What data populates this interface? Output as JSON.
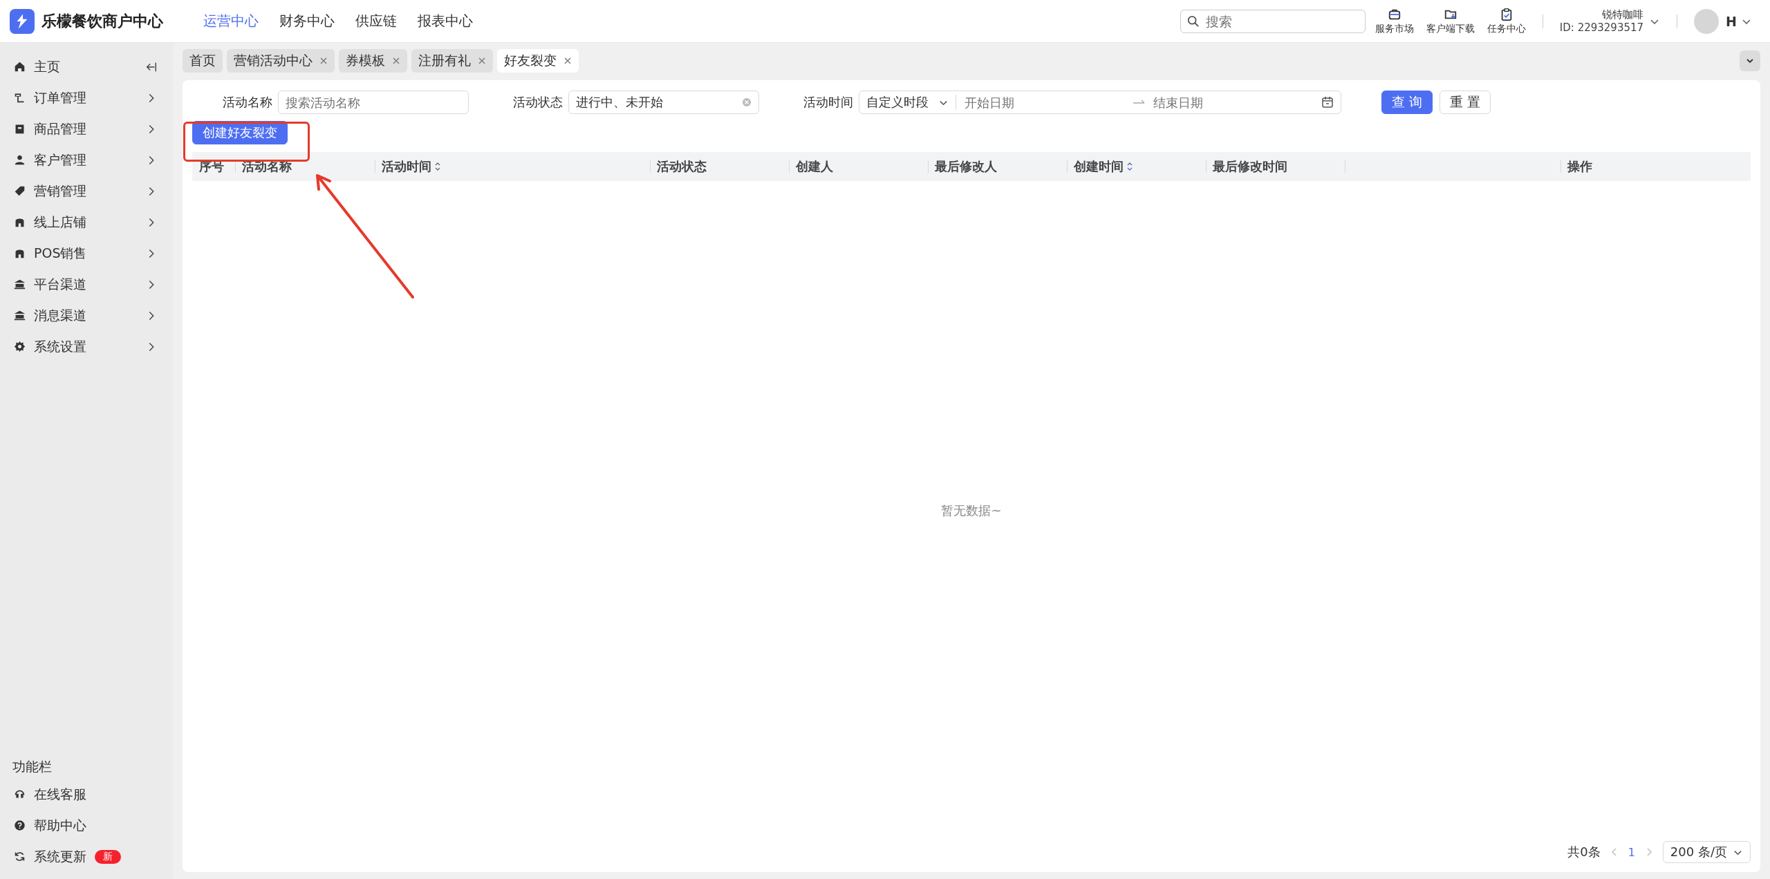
{
  "brand": {
    "name": "乐檬餐饮商户中心"
  },
  "top_nav": [
    {
      "label": "运营中心",
      "selected": true
    },
    {
      "label": "财务中心",
      "selected": false
    },
    {
      "label": "供应链",
      "selected": false
    },
    {
      "label": "报表中心",
      "selected": false
    }
  ],
  "search": {
    "placeholder": "搜索"
  },
  "tools": [
    "服务市场",
    "客户端下载",
    "任务中心"
  ],
  "account": {
    "store": "锐特咖啡",
    "id": "ID: 2293293517",
    "user": "H"
  },
  "sidebar": {
    "items": [
      {
        "label": "主页"
      },
      {
        "label": "订单管理"
      },
      {
        "label": "商品管理"
      },
      {
        "label": "客户管理"
      },
      {
        "label": "营销管理"
      },
      {
        "label": "线上店铺"
      },
      {
        "label": "POS销售"
      },
      {
        "label": "平台渠道"
      },
      {
        "label": "消息渠道"
      },
      {
        "label": "系统设置"
      }
    ],
    "footer_title": "功能栏",
    "footer_items": [
      {
        "label": "在线客服"
      },
      {
        "label": "帮助中心"
      },
      {
        "label": "系统更新",
        "badge": "新"
      }
    ]
  },
  "tabs": [
    {
      "label": "首页",
      "selected": false,
      "closable": false
    },
    {
      "label": "营销活动中心",
      "selected": false,
      "closable": true
    },
    {
      "label": "券模板",
      "selected": false,
      "closable": true
    },
    {
      "label": "注册有礼",
      "selected": false,
      "closable": true
    },
    {
      "label": "好友裂变",
      "selected": true,
      "closable": true
    }
  ],
  "filters": {
    "name_label": "活动名称",
    "name_placeholder": "搜索活动名称",
    "status_label": "活动状态",
    "status_value": "进行中、未开始",
    "time_label": "活动时间",
    "time_mode": "自定义时段",
    "start_placeholder": "开始日期",
    "end_placeholder": "结束日期",
    "query": "查 询",
    "reset": "重 置"
  },
  "create_button": "创建好友裂变",
  "table": {
    "columns": [
      {
        "label": "序号",
        "sortable": false
      },
      {
        "label": "活动名称",
        "sortable": false
      },
      {
        "label": "活动时间",
        "sortable": true
      },
      {
        "label": "活动状态",
        "sortable": false
      },
      {
        "label": "创建人",
        "sortable": false
      },
      {
        "label": "最后修改人",
        "sortable": false
      },
      {
        "label": "创建时间",
        "sortable": true
      },
      {
        "label": "最后修改时间",
        "sortable": false
      },
      {
        "sortable": false
      },
      {
        "label": "操作",
        "sortable": false
      }
    ],
    "empty": "暂无数据~"
  },
  "pagination": {
    "total": "共0条",
    "page": "1",
    "size": "200 条/页"
  }
}
